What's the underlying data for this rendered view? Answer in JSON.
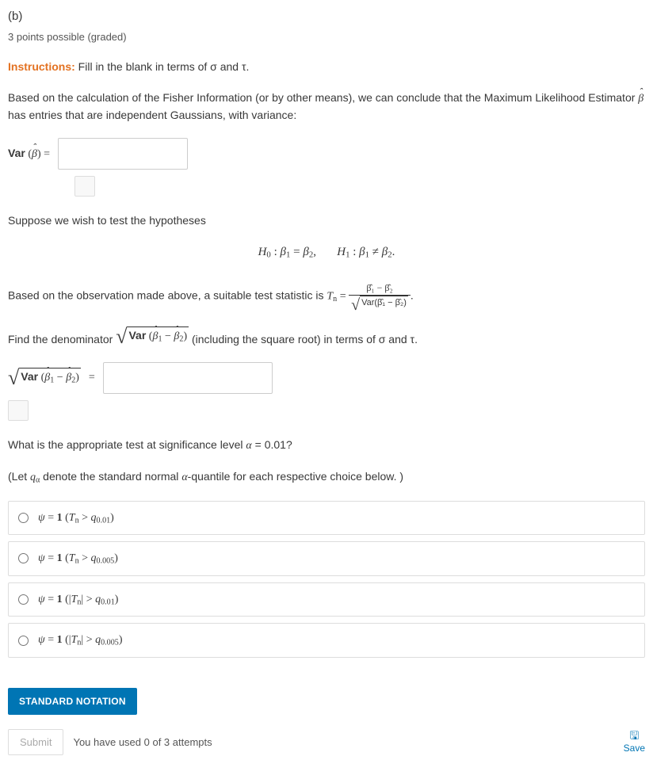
{
  "part_label": "(b)",
  "points": "3 points possible (graded)",
  "instructions_label": "Instructions:",
  "instructions_text": " Fill in the blank in terms of σ and τ.",
  "para1_a": "Based on the calculation of the Fisher Information (or by other means), we can conclude that the Maximum Likelihood Estimator ",
  "para1_b": " has entries that are independent Gaussians, with variance:",
  "var_label_pre": "Var",
  "beta_hat": "β̂",
  "eq": " = ",
  "para2": "Suppose we wish to test the hypotheses",
  "hyp_H0": "H",
  "hyp_0": "0",
  "hyp_colon": " : ",
  "b1": "β",
  "s1": "1",
  "s2": "2",
  "hyp_eq": " = ",
  "hyp_comma": ",",
  "hyp_H1": "H",
  "hyp_1": "1",
  "hyp_neq": " ≠ ",
  "hyp_period": ".",
  "para3_a": "Based on the observation made above, a suitable test statistic is ",
  "Tn": "T",
  "Tn_sub": "n",
  "frac_num": "β̂₁ − β̂₂",
  "frac_den_var": "Var(β̂₁ − β̂₂)",
  "para3_b": ".",
  "para4_a": "Find the denominator ",
  "para4_b": " (including the square root) in terms of σ and τ.",
  "var_inner": "Var (β̂₁ − β̂₂)",
  "q_test": "What is the appropriate test at significance level α = 0.01?",
  "q_let": "(Let qα denote the standard normal α-quantile for each respective choice below. )",
  "choice1": "ψ = 1 (Tₙ > q₀.₀₁)",
  "choice2": "ψ = 1 (Tₙ > q₀.₀₀₅)",
  "choice3": "ψ = 1 (|Tₙ| > q₀.₀₁)",
  "choice4": "ψ = 1 (|Tₙ| > q₀.₀₀₅)",
  "std_notation": "STANDARD NOTATION",
  "submit": "Submit",
  "attempts": "You have used 0 of 3 attempts",
  "save": "Save"
}
